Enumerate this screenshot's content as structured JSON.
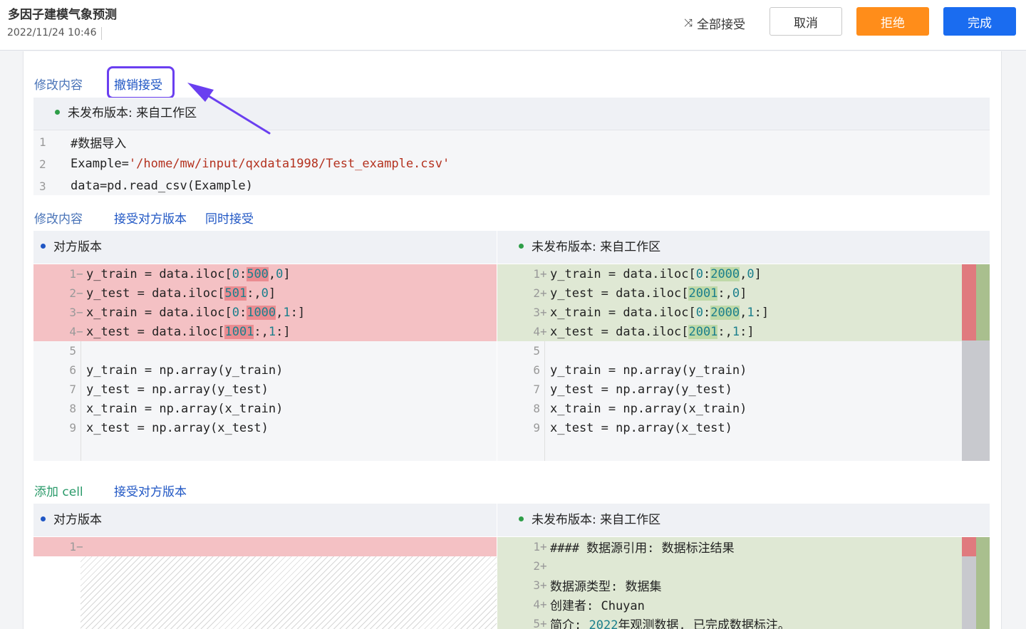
{
  "header": {
    "title": "多因子建模气象预测",
    "timestamp": "2022/11/24 10:46",
    "accept_all": "全部接受",
    "cancel": "取消",
    "reject": "拒绝",
    "done": "完成"
  },
  "section1": {
    "label": "修改内容",
    "undo_accept": "撤销接受",
    "cell_header": "未发布版本: 来自工作区",
    "lines": [
      {
        "n": "1",
        "text": "#数据导入"
      },
      {
        "n": "2",
        "prefix": "Example=",
        "string": "'/home/mw/input/qxdata1998/Test_example.csv'"
      },
      {
        "n": "3",
        "text": "data=pd.read_csv(Example)"
      }
    ]
  },
  "section2": {
    "label": "修改内容",
    "accept_theirs": "接受对方版本",
    "accept_both": "同时接受",
    "left_header": "对方版本",
    "right_header": "未发布版本: 来自工作区",
    "left_changed": [
      {
        "n": "1",
        "mk": "−",
        "a": "y_train = data.iloc[",
        "b": "0",
        "c": ":",
        "d": "500",
        "e": ",",
        "f": "0",
        "g": "]"
      },
      {
        "n": "2",
        "mk": "−",
        "a": "y_test = data.iloc[",
        "d": "501",
        "c2": ":,",
        "f": "0",
        "g": "]"
      },
      {
        "n": "3",
        "mk": "−",
        "a": "x_train = data.iloc[",
        "b": "0",
        "c": ":",
        "d": "1000",
        "e": ",",
        "f": "1",
        "g": ":]"
      },
      {
        "n": "4",
        "mk": "−",
        "a": "x_test = data.iloc[",
        "d": "1001",
        "c2": ":,",
        "f": "1",
        "g": ":]"
      }
    ],
    "right_changed": [
      {
        "n": "1",
        "mk": "+",
        "a": "y_train = data.iloc[",
        "b": "0",
        "c": ":",
        "d": "2000",
        "e": ",",
        "f": "0",
        "g": "]"
      },
      {
        "n": "2",
        "mk": "+",
        "a": "y_test = data.iloc[",
        "d": "2001",
        "c2": ":,",
        "f": "0",
        "g": "]"
      },
      {
        "n": "3",
        "mk": "+",
        "a": "x_train = data.iloc[",
        "b": "0",
        "c": ":",
        "d": "2000",
        "e": ",",
        "f": "1",
        "g": ":]"
      },
      {
        "n": "4",
        "mk": "+",
        "a": "x_test = data.iloc[",
        "d": "2001",
        "c2": ":,",
        "f": "1",
        "g": ":]"
      }
    ],
    "common": [
      {
        "n": "5",
        "text": ""
      },
      {
        "n": "6",
        "text": "y_train = np.array(y_train)"
      },
      {
        "n": "7",
        "text": "y_test = np.array(y_test)"
      },
      {
        "n": "8",
        "text": "x_train = np.array(x_train)"
      },
      {
        "n": "9",
        "text": "x_test = np.array(x_test)"
      }
    ]
  },
  "section3": {
    "label": "添加 cell",
    "accept_theirs": "接受对方版本",
    "left_header": "对方版本",
    "right_header": "未发布版本: 来自工作区",
    "left_lines": [
      {
        "n": "1",
        "mk": "−"
      }
    ],
    "right_lines": [
      {
        "n": "1",
        "mk": "+",
        "text": "#### 数据源引用: 数据标注结果"
      },
      {
        "n": "2",
        "mk": "+",
        "text": ""
      },
      {
        "n": "3",
        "mk": "+",
        "text": "数据源类型: 数据集"
      },
      {
        "n": "4",
        "mk": "+",
        "text": "创建者: Chuyan"
      },
      {
        "n": "5",
        "mk": "+",
        "text": "简介: ",
        "num": "2022",
        "rest": "年观测数据, 已完成数据标注。"
      }
    ]
  },
  "colors": {
    "primary": "#1a6cf0",
    "reject": "#ff8d1a",
    "deleted": "#f4c1c4",
    "added": "#dfe8d4",
    "annotation": "#6a3ff0"
  }
}
